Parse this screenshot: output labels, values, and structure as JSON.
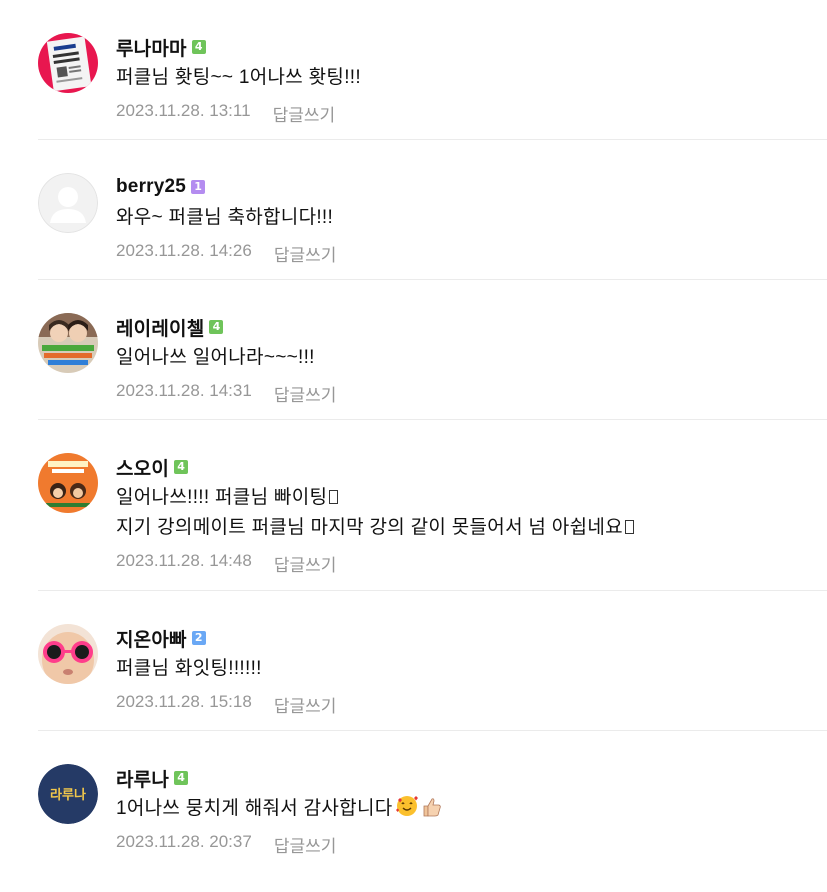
{
  "colors": {
    "badge_green": "#6fc45a",
    "badge_purple": "#b48cf0",
    "badge_blue": "#6aa8f5",
    "meta_gray": "#979797",
    "divider": "#ebebeb"
  },
  "comments": [
    {
      "nickname": "루나마마",
      "level": "4",
      "level_color": "#6fc45a",
      "avatar": "poster-avatar",
      "lines": [
        "퍼클님 홧팅~~ 1어나쓰 홧팅!!!"
      ],
      "date": "2023.11.28. 13:11",
      "reply_label": "답글쓰기"
    },
    {
      "nickname": "berry25",
      "level": "1",
      "level_color": "#b48cf0",
      "avatar": "default-person-avatar",
      "lines": [
        "와우~ 퍼클님 축하합니다!!!"
      ],
      "date": "2023.11.28. 14:26",
      "reply_label": "답글쓰기"
    },
    {
      "nickname": "레이레이첼",
      "level": "4",
      "level_color": "#6fc45a",
      "avatar": "two-people-avatar",
      "lines": [
        "일어나쓰 일어나라~~~!!!"
      ],
      "date": "2023.11.28. 14:31",
      "reply_label": "답글쓰기"
    },
    {
      "nickname": "스오이",
      "level": "4",
      "level_color": "#6fc45a",
      "avatar": "orange-poster-avatar",
      "lines": [
        "일어나쓰!!!! 퍼클님 빠이팅",
        "지기 강의메이트 퍼클님 마지막 강의 같이 못들어서 넘 아쉽네요"
      ],
      "date": "2023.11.28. 14:48",
      "reply_label": "답글쓰기"
    },
    {
      "nickname": "지온아빠",
      "level": "2",
      "level_color": "#6aa8f5",
      "avatar": "child-sunglasses-avatar",
      "lines": [
        "퍼클님 화잇팅!!!!!!"
      ],
      "date": "2023.11.28. 15:18",
      "reply_label": "답글쓰기"
    },
    {
      "nickname": "라루나",
      "level": "4",
      "level_color": "#6fc45a",
      "avatar": "lettering-avatar",
      "avatar_text": "라루나",
      "lines": [
        "1어나쓰 뭉치게 해줘서 감사합니다"
      ],
      "date": "2023.11.28. 20:37",
      "reply_label": "답글쓰기"
    }
  ]
}
